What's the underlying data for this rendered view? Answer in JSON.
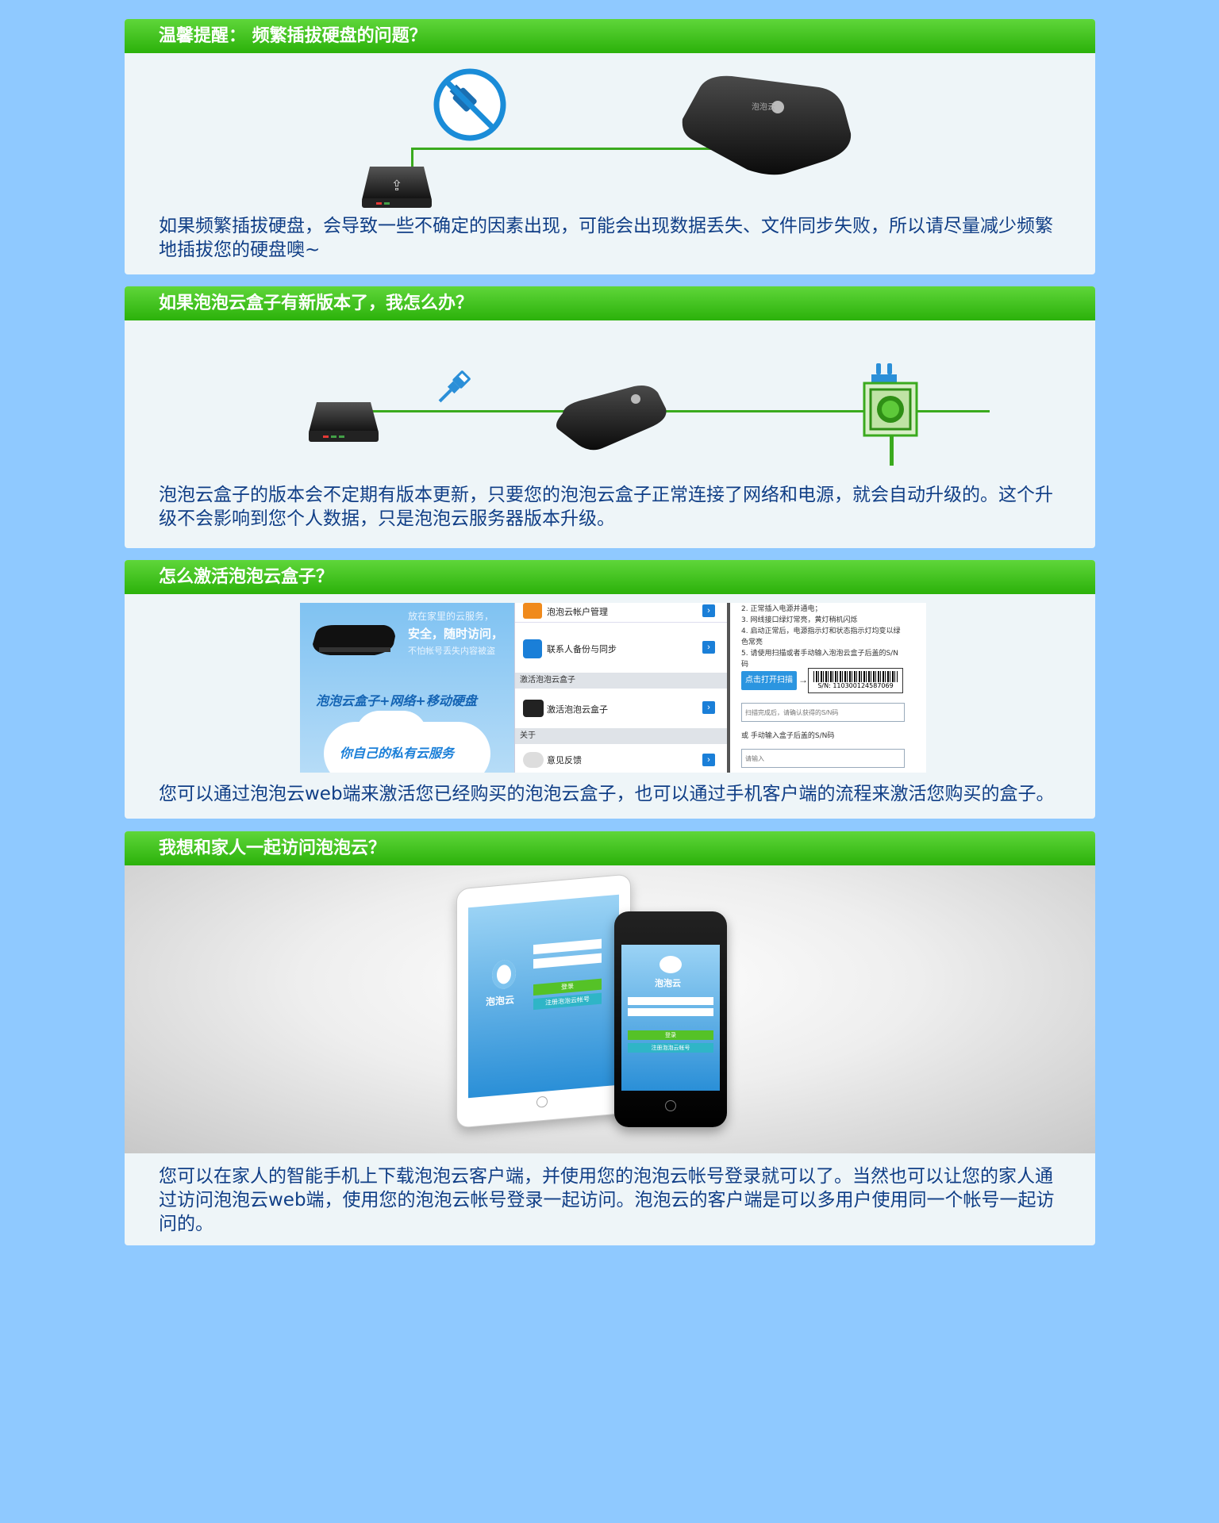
{
  "sections": [
    {
      "title": "温馨提醒： 频繁插拔硬盘的问题？",
      "text": "如果频繁插拔硬盘，会导致一些不确定的因素出现，可能会出现数据丢失、文件同步失败，所以请尽量减少频繁地插拔您的硬盘噢~",
      "box_logo_text": "泡泡云"
    },
    {
      "title": "如果泡泡云盒子有新版本了，我怎么办？",
      "text": "泡泡云盒子的版本会不定期有版本更新，只要您的泡泡云盒子正常连接了网络和电源，就会自动升级的。这个升级不会影响到您个人数据，只是泡泡云服务器版本升级。"
    },
    {
      "title": "怎么激活泡泡云盒子？",
      "text": "您可以通过泡泡云web端来激活您已经购买的泡泡云盒子，也可以通过手机客户端的流程来激活您购买的盒子。",
      "promo": {
        "line1": "放在家里的云服务，",
        "line2": "安全，随时访问，",
        "line3": "不怕帐号丢失内容被盗",
        "formula": "泡泡云盒子+网络+移动硬盘",
        "slogan": "你自己的私有云服务"
      },
      "menu": {
        "items": [
          {
            "label": "泡泡云帐户管理"
          },
          {
            "label": "联系人备份与同步"
          },
          {
            "label": "激活泡泡云盒子"
          },
          {
            "label": "意见反馈"
          }
        ],
        "group_activate": "激活泡泡云盒子",
        "group_about": "关于"
      },
      "steps": {
        "lines": [
          "2. 正常插入电源并通电；",
          "3. 网线接口绿灯常亮，黄灯稍机闪烁",
          "4. 启动正常后，电源指示灯和状态指示灯均变以绿",
          "色常亮",
          "5. 请使用扫描或者手动输入泡泡云盒子后盖的S/N",
          "码"
        ],
        "scan_button": "点击打开扫描",
        "sn_label": "S/N: 110300124587069",
        "scan_placeholder": "扫描完成后，请确认获得的S/N码",
        "manual_label": "或 手动输入盒子后盖的S/N码",
        "manual_placeholder": "请输入"
      }
    },
    {
      "title": "我想和家人一起访问泡泡云？",
      "text": "您可以在家人的智能手机上下载泡泡云客户端，并使用您的泡泡云帐号登录就可以了。当然也可以让您的家人通过访问泡泡云web端，使用您的泡泡云帐号登录一起访问。泡泡云的客户端是可以多用户使用同一个帐号一起访问的。",
      "app_logo": "泡泡云",
      "login_button": "登录",
      "register_button": "注册泡泡云帐号",
      "phone_register_button": "注册泡泡云帐号"
    }
  ],
  "colors": {
    "page_bg": "#8fc9ff",
    "header_green": "#2bb10a",
    "text_blue": "#103e86",
    "line_green": "#3aaa1e"
  }
}
